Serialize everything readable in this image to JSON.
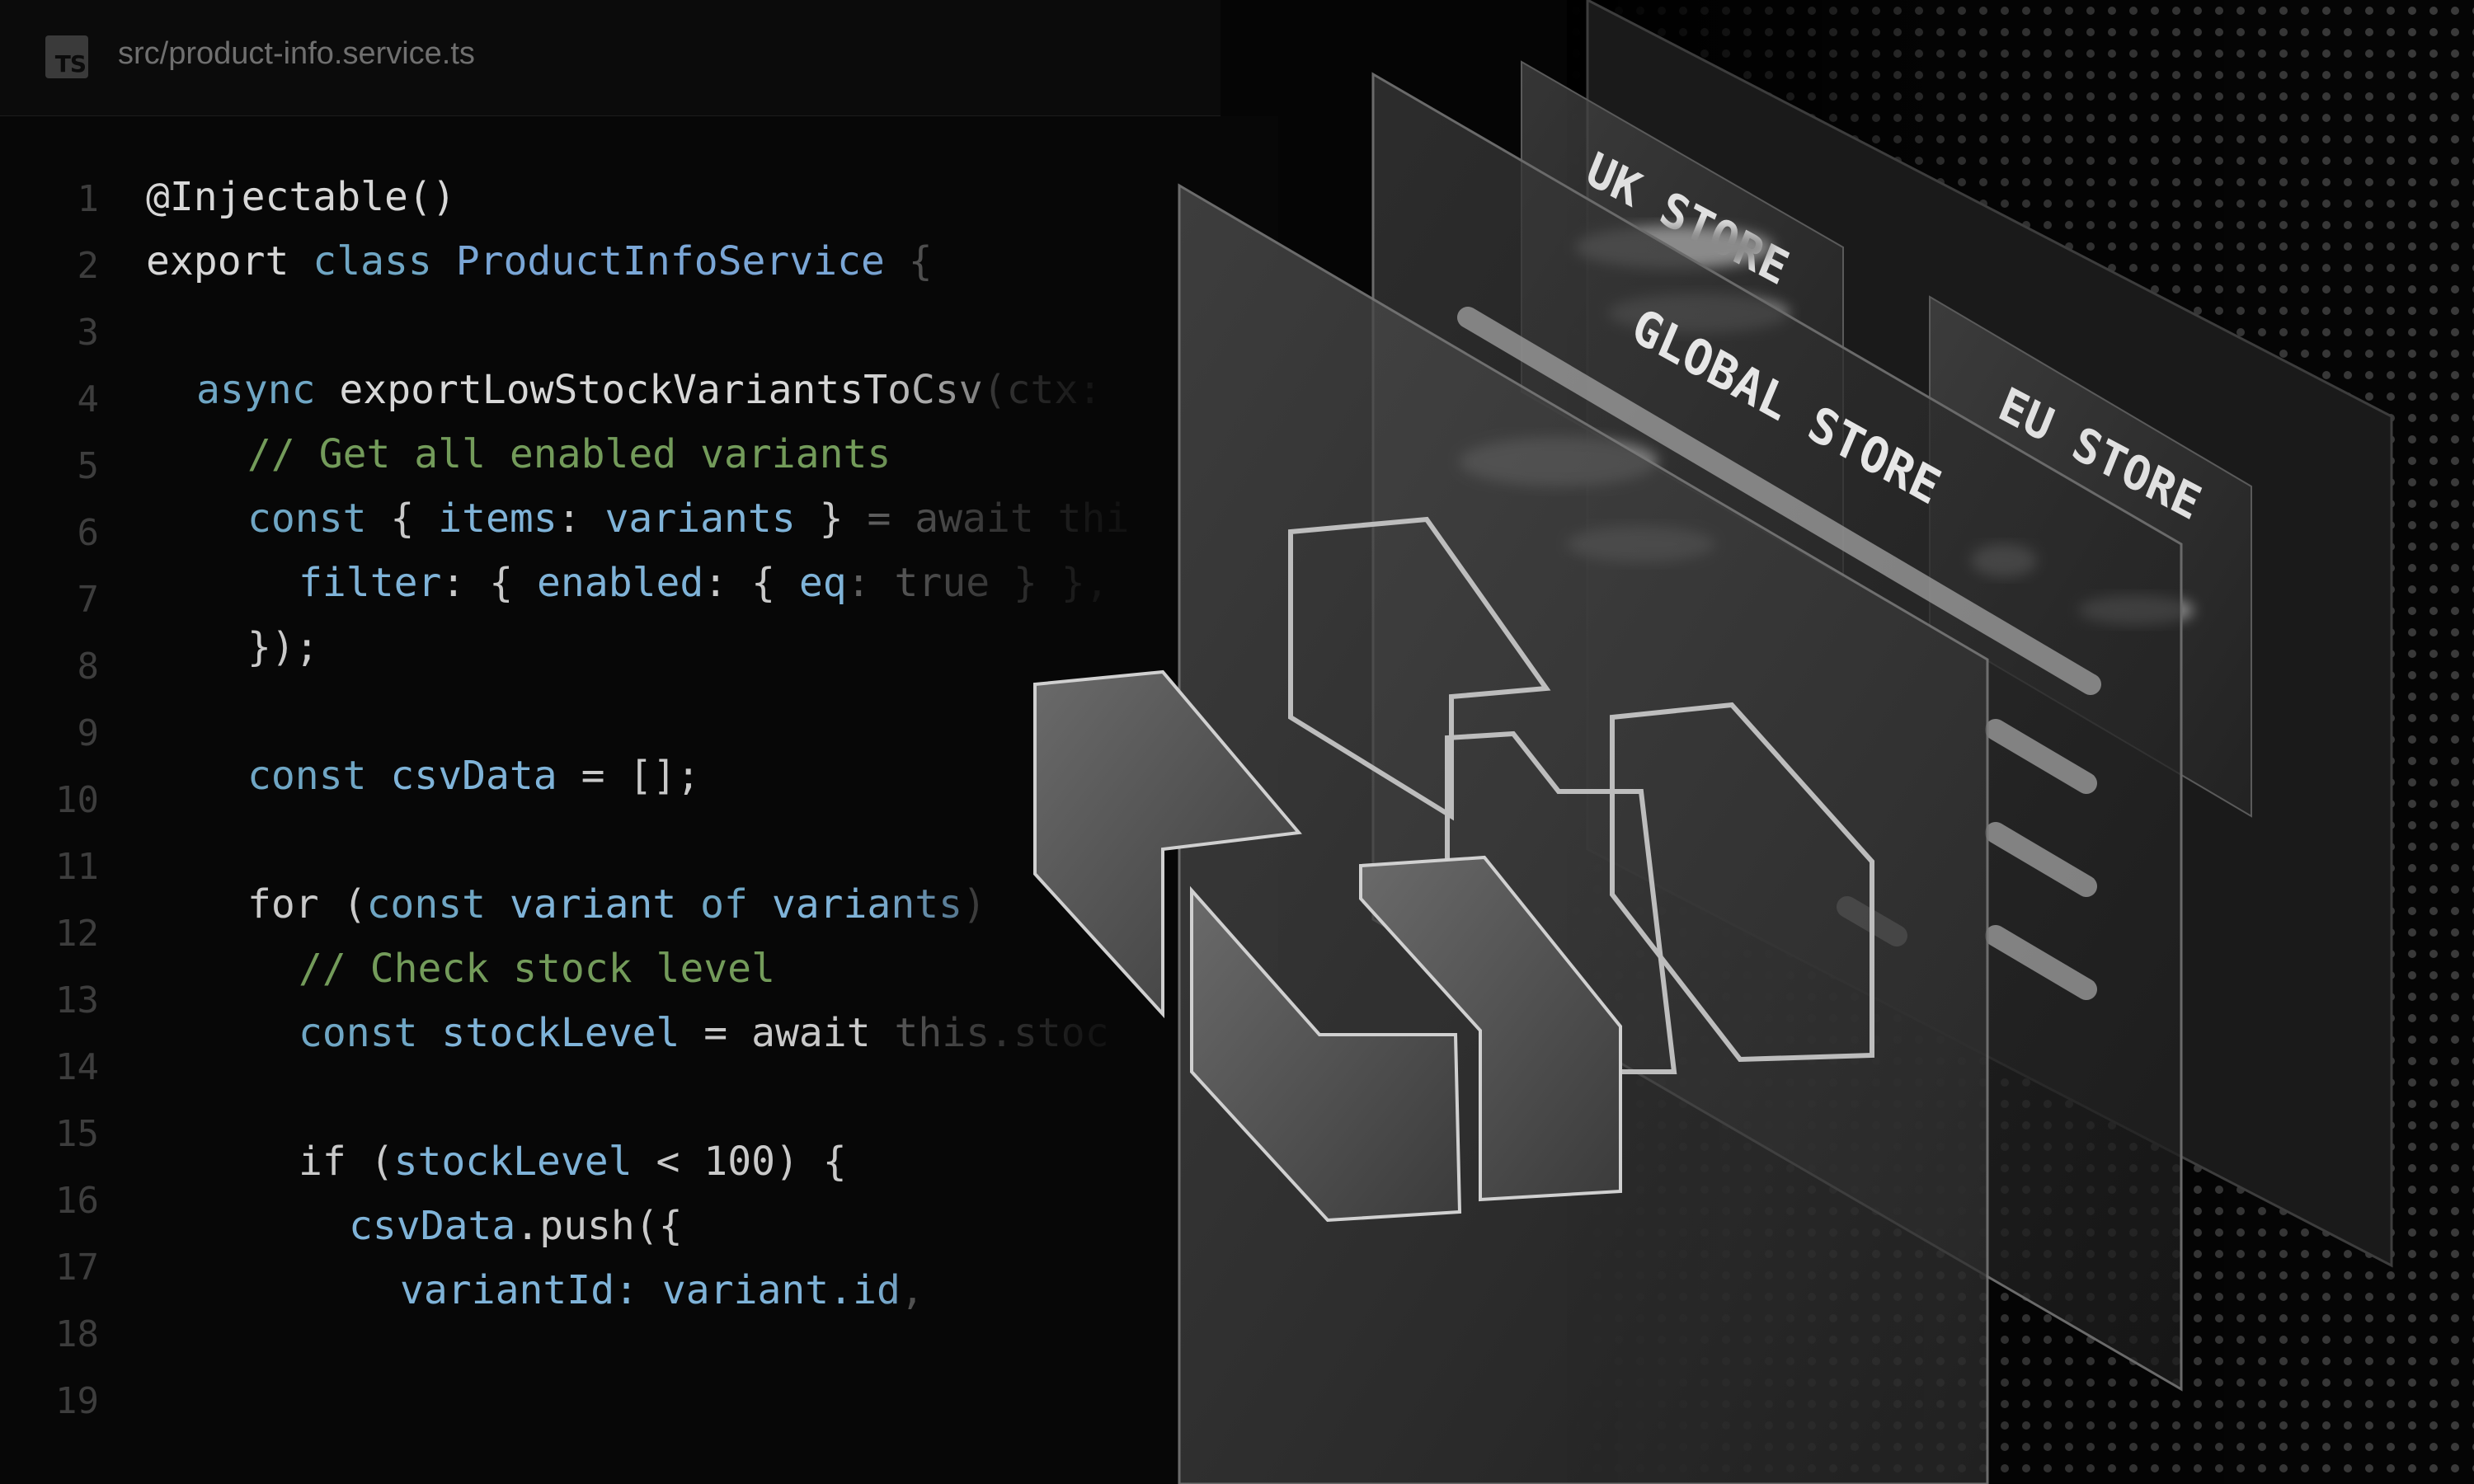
{
  "tab": {
    "icon_label": "TS",
    "file_path": "src/product-info.service.ts"
  },
  "gutter": {
    "line_numbers": [
      "1",
      "2",
      "3",
      "4",
      "5",
      "6",
      "7",
      "8",
      "9",
      "10",
      "11",
      "12",
      "13",
      "14",
      "15",
      "16",
      "17",
      "18",
      "19"
    ]
  },
  "code": {
    "l1": "@Injectable()",
    "l2_kw1": "export",
    "l2_kw2": "class",
    "l2_name": "ProductInfoService",
    "l2_brace": "{",
    "l4_kw": "async",
    "l4_fn": "exportLowStockVariantsToCsv",
    "l4_rest": "(ctx:",
    "l5": "// Get all enabled variants",
    "l6_kw": "const",
    "l6_a": "{",
    "l6_items": "items",
    "l6_b": ":",
    "l6_variants": "variants",
    "l6_c": "}",
    "l6_eq": "=",
    "l6_await": "await",
    "l6_this": "thi",
    "l7_filter": "filter",
    "l7_a": ": {",
    "l7_enabled": "enabled",
    "l7_b": ": {",
    "l7_eq": "eq",
    "l7_c": ":",
    "l7_true": "true",
    "l7_d": "} },",
    "l8": "});",
    "l10_kw": "const",
    "l10_var": "csvData",
    "l10_rest": "= [];",
    "l12_for": "for",
    "l12_paren": "(",
    "l12_kw": "const",
    "l12_var": "variant",
    "l12_of": "of",
    "l12_vars": "variants",
    "l12_close": ")",
    "l13": "// Check stock level",
    "l14_kw": "const",
    "l14_var": "stockLevel",
    "l14_eq": "=",
    "l14_await": "await",
    "l14_this": "this.stoc",
    "l16_if": "if",
    "l16_a": "(",
    "l16_var": "stockLevel",
    "l16_b": "< 100) {",
    "l17_var": "csvData",
    "l17_rest": ".push({",
    "l18_prop": "variantId",
    "l18_a": ":",
    "l18_val": "variant.id",
    "l18_b": ","
  },
  "stores": {
    "uk": "UK STORE",
    "global": "GLOBAL STORE",
    "eu": "EU STORE"
  }
}
